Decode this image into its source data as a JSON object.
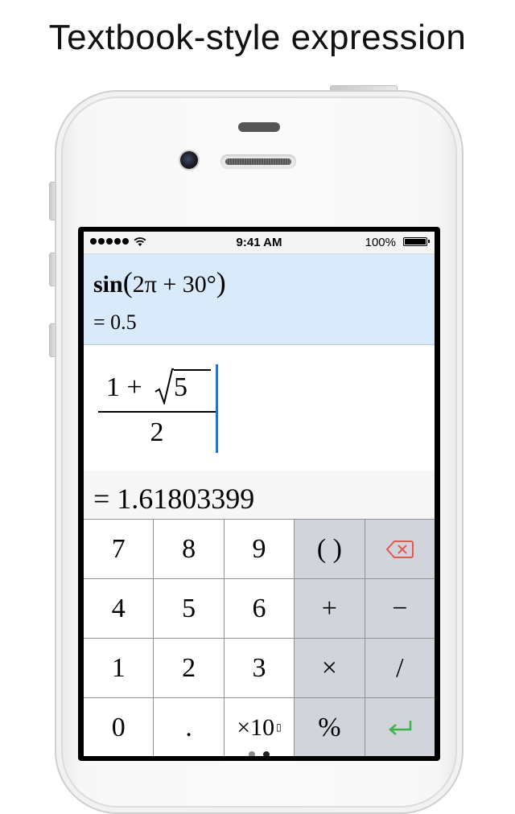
{
  "caption": "Textbook-style expression",
  "status_bar": {
    "time": "9:41 AM",
    "battery": "100%"
  },
  "history": {
    "func": "sin",
    "open_paren": "(",
    "args": "2π + 30°",
    "close_paren": ")",
    "result": "= 0.5"
  },
  "editor": {
    "numerator_prefix": "1 + ",
    "sqrt_content": "5",
    "denominator": "2"
  },
  "result": "= 1.61803399",
  "keypad": {
    "rows": [
      [
        "7",
        "8",
        "9",
        "( )",
        "⌫"
      ],
      [
        "4",
        "5",
        "6",
        "+",
        "−"
      ],
      [
        "1",
        "2",
        "3",
        "×",
        "/"
      ],
      [
        "0",
        ".",
        "×10",
        "%",
        "↵"
      ]
    ]
  },
  "colors": {
    "history_bg": "#d9eafb",
    "cursor": "#1e74d6",
    "operator_key": "#d1d5db",
    "backspace": "#e05a4e",
    "enter": "#3ab54a"
  },
  "icons": {
    "backspace": "backspace-icon",
    "enter": "return-icon",
    "wifi": "wifi-icon",
    "battery": "battery-icon"
  }
}
